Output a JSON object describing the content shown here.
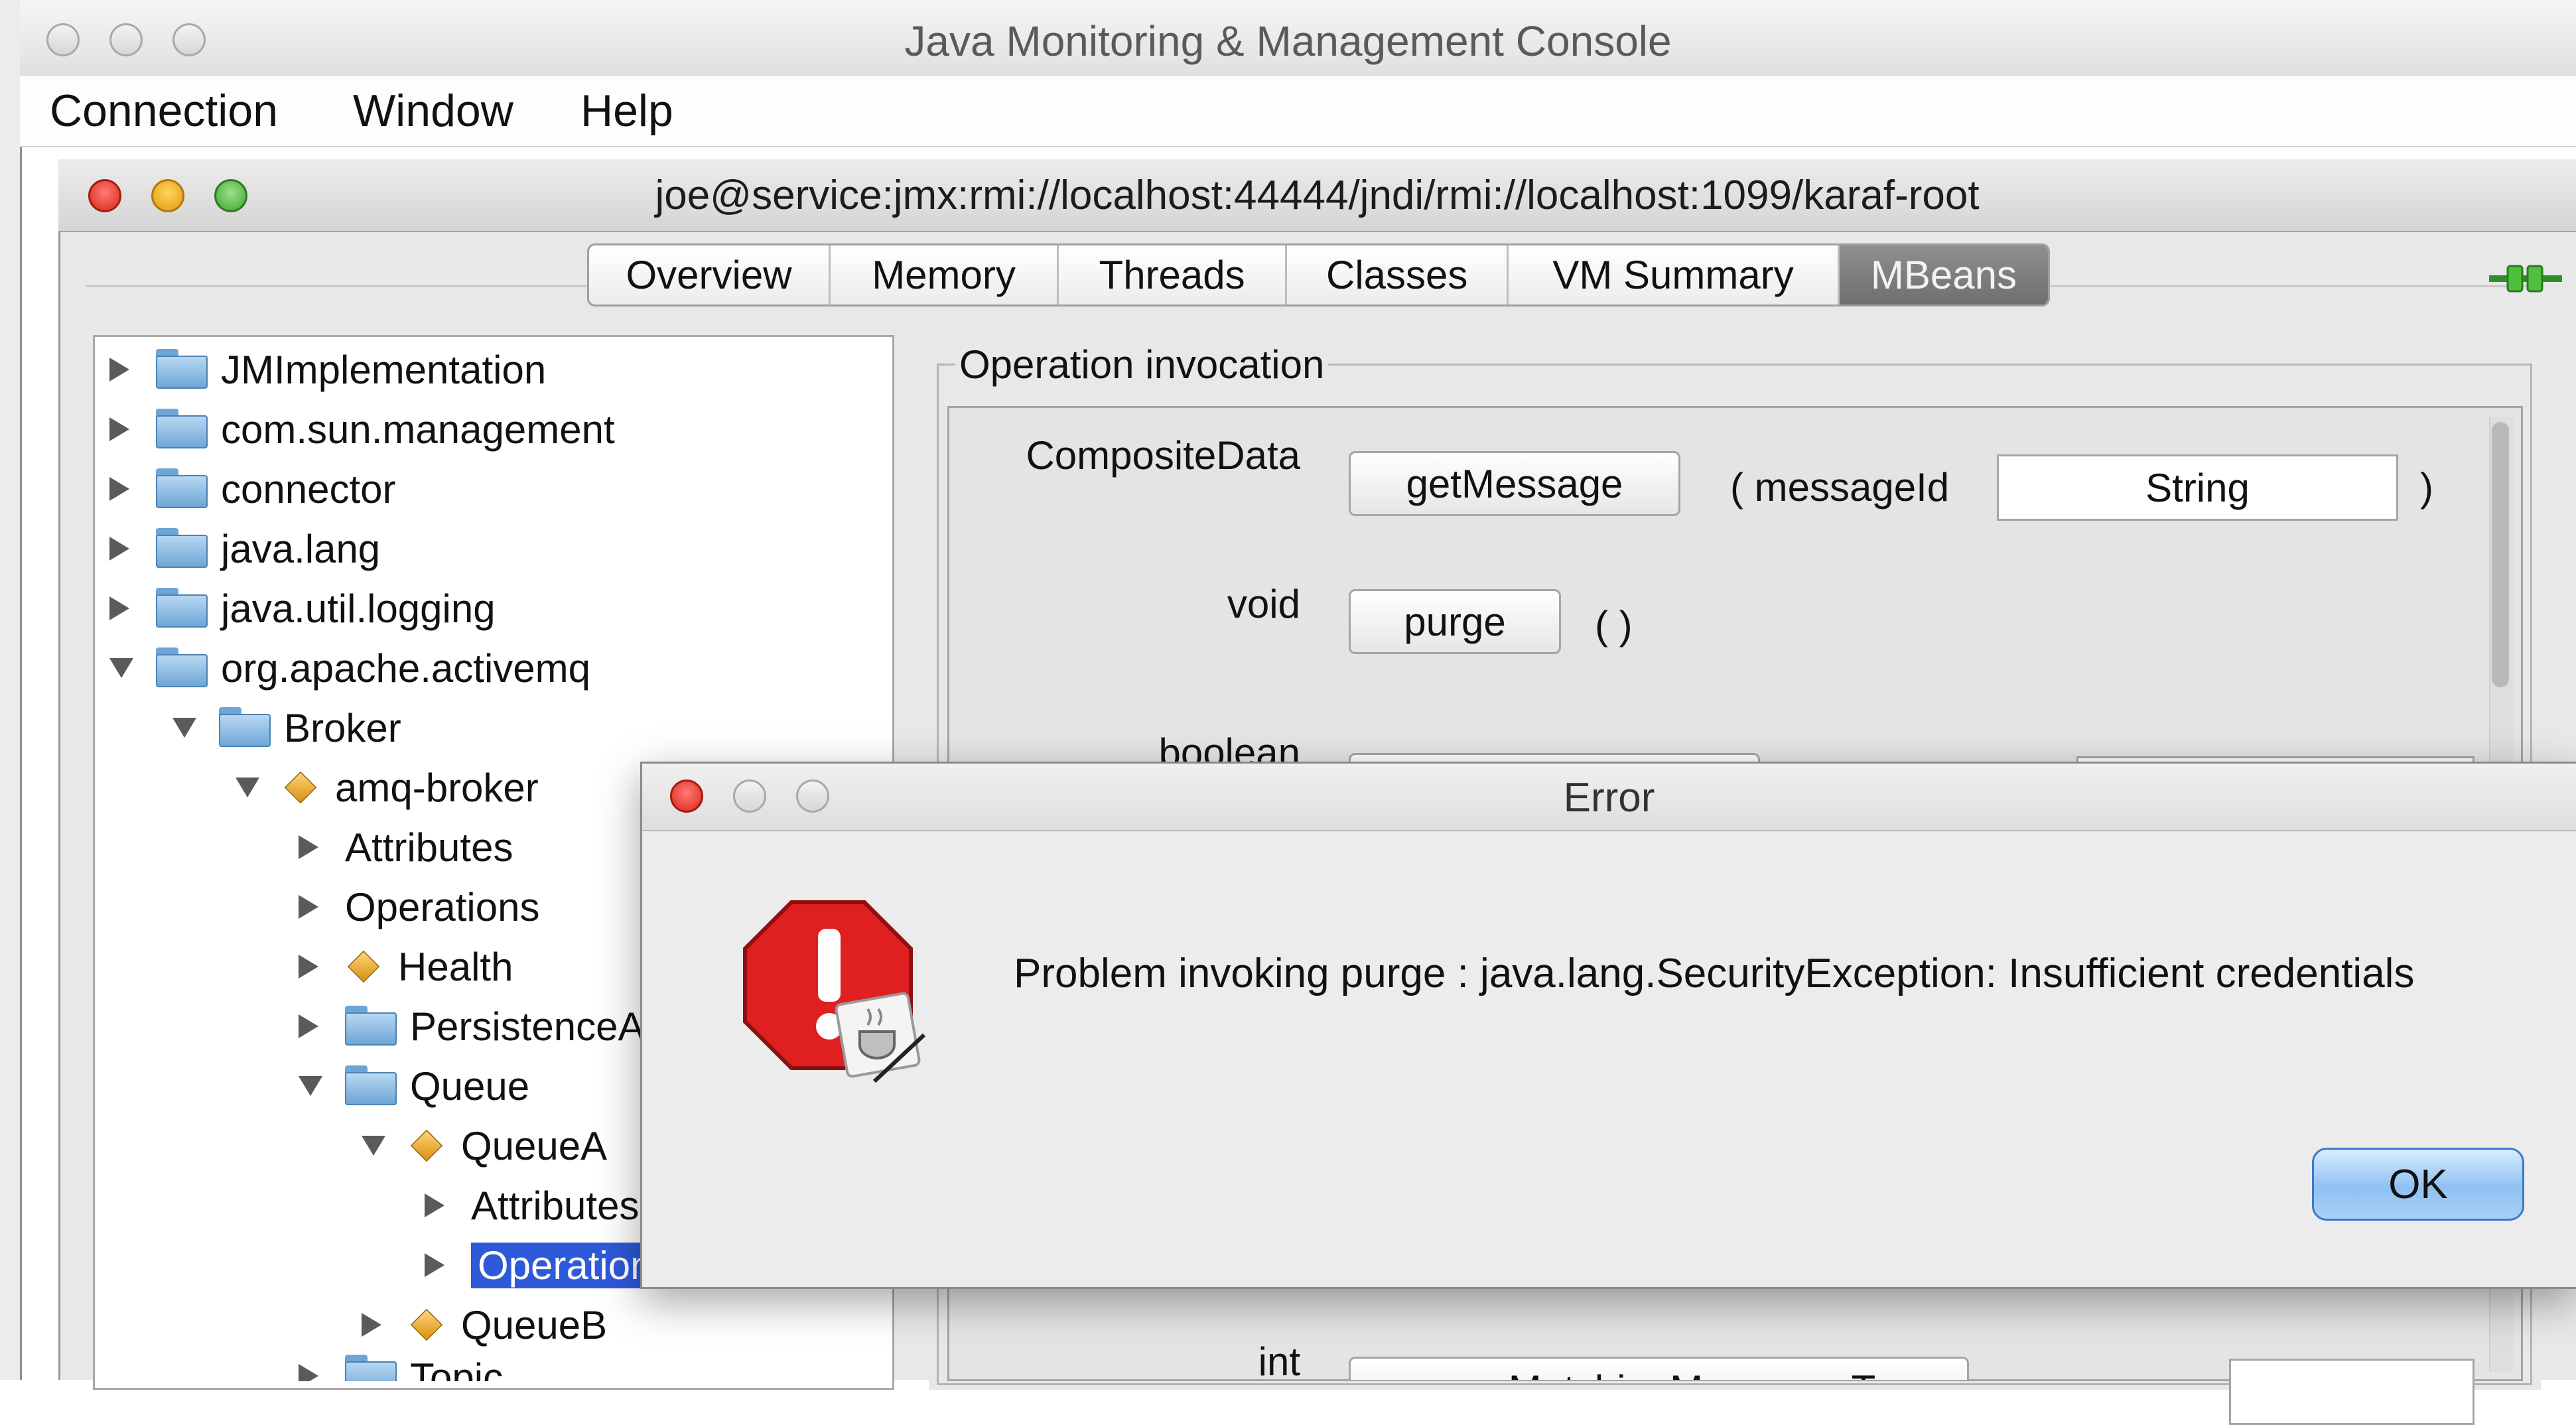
{
  "app": {
    "title": "Java Monitoring & Management Console",
    "menu": [
      "Connection",
      "Window",
      "Help"
    ]
  },
  "connection_window": {
    "title": "joe@service:jmx:rmi://localhost:44444/jndi/rmi://localhost:1099/karaf-root"
  },
  "tabs": [
    "Overview",
    "Memory",
    "Threads",
    "Classes",
    "VM Summary",
    "MBeans"
  ],
  "active_tab": "MBeans",
  "tree": [
    {
      "label": "JMImplementation",
      "icon": "folder-icon",
      "expanded": false
    },
    {
      "label": "com.sun.management",
      "icon": "folder-icon",
      "expanded": false
    },
    {
      "label": "connector",
      "icon": "folder-icon",
      "expanded": false
    },
    {
      "label": "java.lang",
      "icon": "folder-icon",
      "expanded": false
    },
    {
      "label": "java.util.logging",
      "icon": "folder-icon",
      "expanded": false
    },
    {
      "label": "org.apache.activemq",
      "icon": "folder-icon",
      "expanded": true
    },
    {
      "label": "Broker",
      "icon": "folder-icon",
      "expanded": true
    },
    {
      "label": "amq-broker",
      "icon": "mbean-icon",
      "expanded": true
    },
    {
      "label": "Attributes",
      "icon": "",
      "expanded": false
    },
    {
      "label": "Operations",
      "icon": "",
      "expanded": false
    },
    {
      "label": "Health",
      "icon": "mbean-icon",
      "expanded": false
    },
    {
      "label": "PersistenceA",
      "icon": "folder-icon",
      "expanded": false
    },
    {
      "label": "Queue",
      "icon": "folder-icon",
      "expanded": true
    },
    {
      "label": "QueueA",
      "icon": "mbean-icon",
      "expanded": true
    },
    {
      "label": "Attributes",
      "icon": "",
      "expanded": false
    },
    {
      "label": "Operation",
      "icon": "",
      "expanded": false,
      "selected": true
    },
    {
      "label": "QueueB",
      "icon": "mbean-icon",
      "expanded": false
    },
    {
      "label": "Topic",
      "icon": "folder-icon",
      "expanded": false
    }
  ],
  "operations": {
    "legend": "Operation invocation",
    "rows": [
      {
        "return_type": "CompositeData",
        "button": "getMessage",
        "open": "( messageId",
        "param": "String",
        "close": ")"
      },
      {
        "return_type": "void",
        "button": "purge",
        "open": "( )"
      },
      {
        "return_type": "boolean"
      },
      {
        "return_type": "int",
        "button": "copyMatchingMessagesTo"
      }
    ]
  },
  "error_dialog": {
    "title": "Error",
    "message": "Problem invoking purge : java.lang.SecurityException: Insufficient credentials",
    "ok_label": "OK",
    "icon": "error-stop-icon"
  },
  "colors": {
    "selection": "#2e59d9",
    "active_tab": "#7a7a7a",
    "ok_button": "#8fc1f2"
  }
}
